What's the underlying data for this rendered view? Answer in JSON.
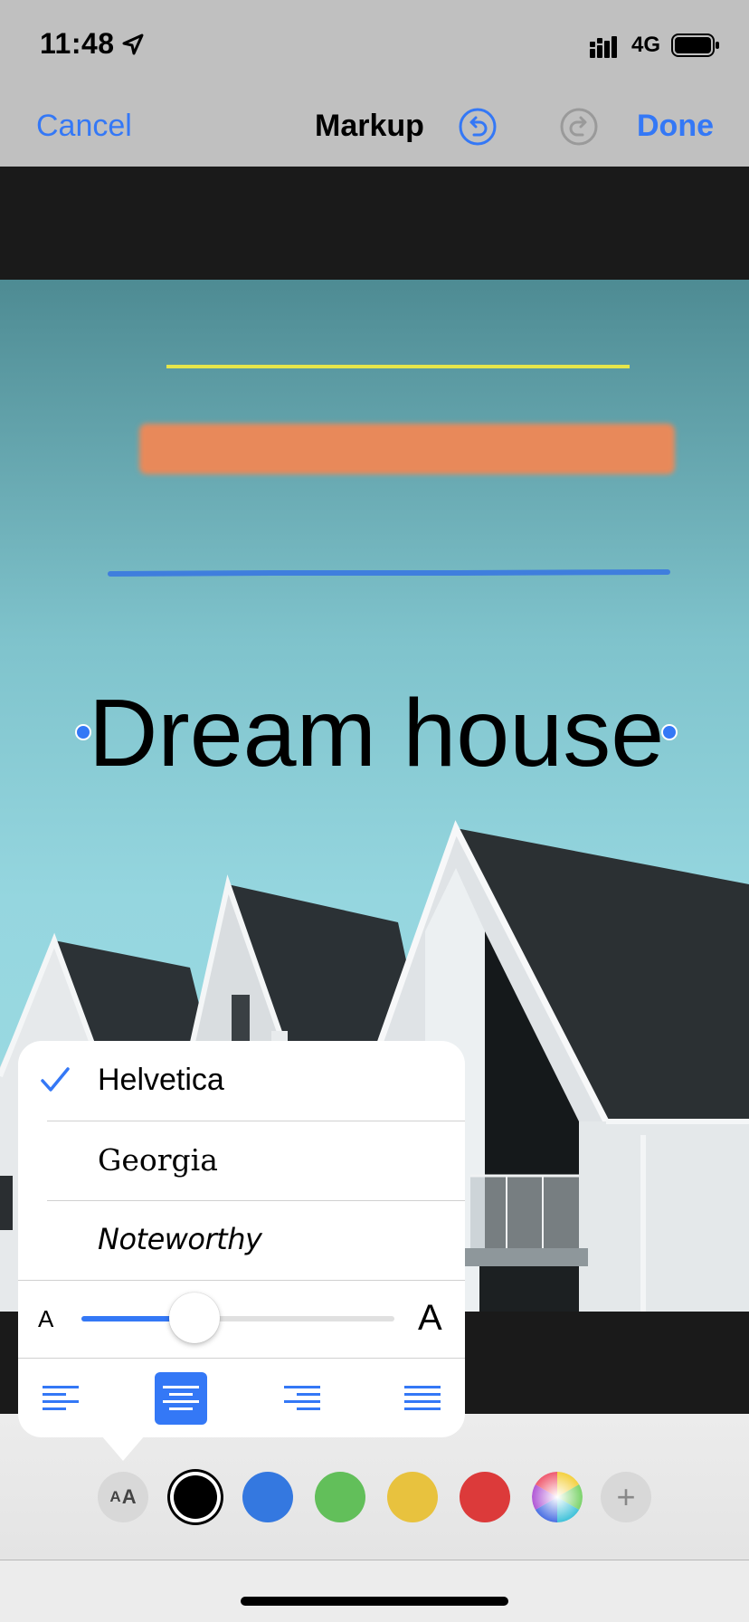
{
  "status_bar": {
    "time": "11:48",
    "network": "4G",
    "icons": [
      "location-arrow-icon",
      "signal-bars-icon",
      "battery-icon"
    ]
  },
  "nav": {
    "cancel_label": "Cancel",
    "title": "Markup",
    "done_label": "Done",
    "undo_icon": "undo-icon",
    "redo_icon": "redo-icon"
  },
  "canvas": {
    "text_annotation": "Dream house",
    "strokes": [
      {
        "tool": "pen",
        "color": "#e6e64a"
      },
      {
        "tool": "marker",
        "color": "#e8895a"
      },
      {
        "tool": "pencil",
        "color": "#3a78e0"
      }
    ]
  },
  "font_popover": {
    "fonts": [
      {
        "name": "Helvetica",
        "selected": true
      },
      {
        "name": "Georgia",
        "selected": false
      },
      {
        "name": "Noteworthy",
        "selected": false
      }
    ],
    "size_small_label": "A",
    "size_large_label": "A",
    "size_level": 0.36,
    "alignments": [
      {
        "name": "align-left",
        "selected": false
      },
      {
        "name": "align-center",
        "selected": true
      },
      {
        "name": "align-right",
        "selected": false
      },
      {
        "name": "align-justify",
        "selected": false
      }
    ]
  },
  "toolbar": {
    "font_button": "AA",
    "font_button_small": "A",
    "font_button_large": "A",
    "colors": [
      {
        "name": "black",
        "hex": "#000000",
        "selected": true
      },
      {
        "name": "blue",
        "hex": "#3478e0",
        "selected": false
      },
      {
        "name": "green",
        "hex": "#62bf5a",
        "selected": false
      },
      {
        "name": "yellow",
        "hex": "#e8c23e",
        "selected": false
      },
      {
        "name": "red",
        "hex": "#dc3a3a",
        "selected": false
      }
    ],
    "color_wheel_icon": "color-wheel-icon",
    "add_label": "+"
  },
  "accent_color": "#3478f6"
}
